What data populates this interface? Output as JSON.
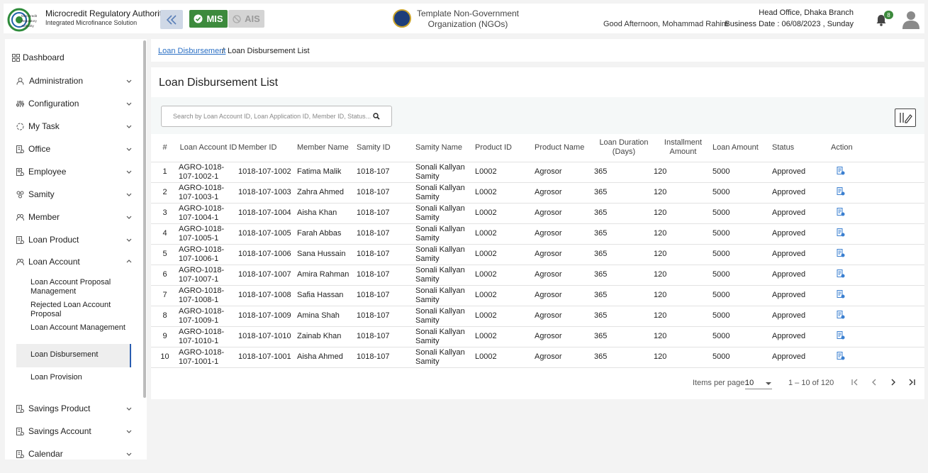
{
  "header": {
    "org_title": "Microcredit Regulatory Authority",
    "org_subtitle": "Integrated Microfinance Solution",
    "logo_text": "Microcredit Regulatory Authority",
    "mis_label": "MIS",
    "ais_label": "AIS",
    "ngo_name": "Template Non-Government Organization (NGOs)",
    "greeting": "Good Afternoon, Mohammad Rahim",
    "branch": "Head Office, Dhaka Branch",
    "business_date": "Business Date : 06/08/2023 , Sunday",
    "notification_count": "8",
    "accent_color": "#3c8a3c"
  },
  "sidebar": {
    "dashboard": "Dashboard",
    "items": [
      {
        "label": "Administration",
        "icon": "admin-icon"
      },
      {
        "label": "Configuration",
        "icon": "config-icon"
      },
      {
        "label": "My Task",
        "icon": "task-icon"
      },
      {
        "label": "Office",
        "icon": "office-icon"
      },
      {
        "label": "Employee",
        "icon": "employee-icon"
      },
      {
        "label": "Samity",
        "icon": "samity-icon"
      },
      {
        "label": "Member",
        "icon": "member-icon"
      },
      {
        "label": "Loan Product",
        "icon": "loan-product-icon"
      },
      {
        "label": "Loan Account",
        "icon": "loan-account-icon"
      }
    ],
    "sub_items": [
      "Loan Account Proposal Management",
      "Rejected Loan Account Proposal",
      "Loan Account Management",
      "Loan Disbursement",
      "Loan Provision"
    ],
    "bottom_items": [
      {
        "label": "Savings Product",
        "icon": "savings-product-icon"
      },
      {
        "label": "Savings Account",
        "icon": "savings-account-icon"
      },
      {
        "label": "Calendar",
        "icon": "calendar-icon"
      }
    ]
  },
  "breadcrumb": {
    "link": "Loan Disbursement",
    "separator": "/",
    "current": "Loan Disbursement List"
  },
  "main": {
    "title": "Loan Disbursement List",
    "search_placeholder": "Search by Loan Account ID, Loan Application ID, Member ID, Status...",
    "columns": [
      "#",
      "Loan Account ID",
      "Member ID",
      "Member Name",
      "Samity ID",
      "Samity Name",
      "Product ID",
      "Product Name",
      "Loan Duration (Days)",
      "Installment Amount",
      "Loan Amount",
      "Status",
      "Action"
    ],
    "rows": [
      [
        "1",
        "AGRO-1018-107-1002-1",
        "1018-107-1002",
        "Fatima Malik",
        "1018-107",
        "Sonali Kallyan Samity",
        "L0002",
        "Agrosor",
        "365",
        "120",
        "5000",
        "Approved"
      ],
      [
        "2",
        "AGRO-1018-107-1003-1",
        "1018-107-1003",
        "Zahra Ahmed",
        "1018-107",
        "Sonali Kallyan Samity",
        "L0002",
        "Agrosor",
        "365",
        "120",
        "5000",
        "Approved"
      ],
      [
        "3",
        "AGRO-1018-107-1004-1",
        "1018-107-1004",
        "Aisha Khan",
        "1018-107",
        "Sonali Kallyan Samity",
        "L0002",
        "Agrosor",
        "365",
        "120",
        "5000",
        "Approved"
      ],
      [
        "4",
        "AGRO-1018-107-1005-1",
        "1018-107-1005",
        "Farah Abbas",
        "1018-107",
        "Sonali Kallyan Samity",
        "L0002",
        "Agrosor",
        "365",
        "120",
        "5000",
        "Approved"
      ],
      [
        "5",
        "AGRO-1018-107-1006-1",
        "1018-107-1006",
        "Sana Hussain",
        "1018-107",
        "Sonali Kallyan Samity",
        "L0002",
        "Agrosor",
        "365",
        "120",
        "5000",
        "Approved"
      ],
      [
        "6",
        "AGRO-1018-107-1007-1",
        "1018-107-1007",
        "Amira Rahman",
        "1018-107",
        "Sonali Kallyan Samity",
        "L0002",
        "Agrosor",
        "365",
        "120",
        "5000",
        "Approved"
      ],
      [
        "7",
        "AGRO-1018-107-1008-1",
        "1018-107-1008",
        "Safia Hassan",
        "1018-107",
        "Sonali Kallyan Samity",
        "L0002",
        "Agrosor",
        "365",
        "120",
        "5000",
        "Approved"
      ],
      [
        "8",
        "AGRO-1018-107-1009-1",
        "1018-107-1009",
        "Amina Shah",
        "1018-107",
        "Sonali Kallyan Samity",
        "L0002",
        "Agrosor",
        "365",
        "120",
        "5000",
        "Approved"
      ],
      [
        "9",
        "AGRO-1018-107-1010-1",
        "1018-107-1010",
        "Zainab Khan",
        "1018-107",
        "Sonali Kallyan Samity",
        "L0002",
        "Agrosor",
        "365",
        "120",
        "5000",
        "Approved"
      ],
      [
        "10",
        "AGRO-1018-107-1001-1",
        "1018-107-1001",
        "Aisha Ahmed",
        "1018-107",
        "Sonali Kallyan Samity",
        "L0002",
        "Agrosor",
        "365",
        "120",
        "5000",
        "Approved"
      ]
    ],
    "action_icon": "edit-document-icon"
  },
  "pagination": {
    "items_per_page_label": "Items per page:",
    "items_per_page": "10",
    "range": "1 – 10 of 120"
  }
}
